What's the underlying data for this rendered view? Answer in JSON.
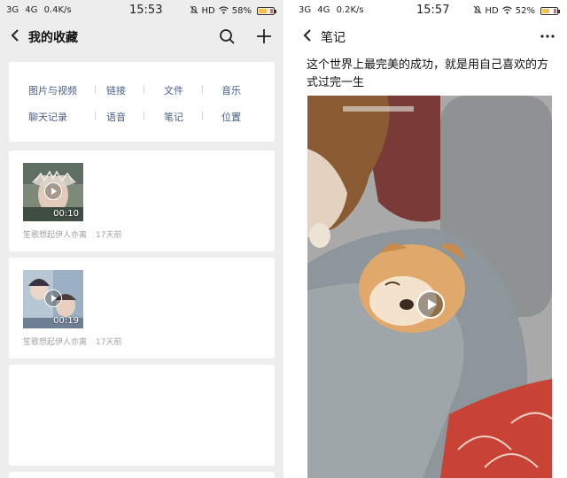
{
  "left": {
    "status": {
      "network": "3G   4G   0.4K/s",
      "time": "15:53",
      "hd": "HD",
      "battery": "58%",
      "battery_level": 0.58
    },
    "nav": {
      "title": "我的收藏",
      "back_icon": "back-arrow-icon",
      "search_icon": "search-icon",
      "add_icon": "plus-icon"
    },
    "categories": [
      "图片与视频",
      "链接",
      "文件",
      "音乐",
      "聊天记录",
      "语音",
      "笔记",
      "位置"
    ],
    "items": [
      {
        "duration": "00:10",
        "source": "笙歌想起伊人亦离",
        "time": "17天前"
      },
      {
        "duration": "00:19",
        "source": "笙歌想起伊人亦离",
        "time": "17天前"
      }
    ]
  },
  "right": {
    "status": {
      "network": "3G   4G   0.2K/s",
      "time": "15:57",
      "hd": "HD",
      "battery": "52%",
      "battery_level": 0.52
    },
    "nav": {
      "title": "笔记",
      "back_icon": "back-arrow-icon",
      "more_icon": "more-dots-icon"
    },
    "note_text": "这个世界上最完美的成功，就是用自己喜欢的方式过完一生"
  },
  "colors": {
    "link_blue": "#4a6087",
    "meta_gray": "#a2a2a2",
    "background": "#ededed"
  }
}
